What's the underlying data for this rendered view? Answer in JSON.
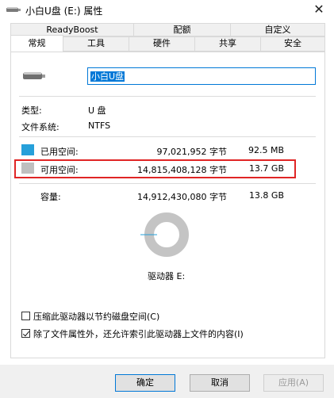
{
  "window": {
    "title": "小白U盘 (E:) 属性",
    "close_symbol": "✕"
  },
  "tabs_row1": [
    "ReadyBoost",
    "配额",
    "自定义"
  ],
  "tabs_row2": [
    "常规",
    "工具",
    "硬件",
    "共享",
    "安全"
  ],
  "active_tab": "常规",
  "drive": {
    "name": "小白U盘"
  },
  "info": {
    "type_label": "类型:",
    "type_value": "U 盘",
    "fs_label": "文件系统:",
    "fs_value": "NTFS"
  },
  "space": {
    "used_label": "已用空间:",
    "used_bytes": "97,021,952 字节",
    "used_size": "92.5 MB",
    "used_color": "#26a0da",
    "free_label": "可用空间:",
    "free_bytes": "14,815,408,128 字节",
    "free_size": "13.7 GB",
    "free_color": "#bfbfbf",
    "cap_label": "容量:",
    "cap_bytes": "14,912,430,080 字节",
    "cap_size": "13.8 GB",
    "drive_label": "驱动器 E:"
  },
  "options": {
    "compress_label": "压缩此驱动器以节约磁盘空间(C)",
    "compress_checked": false,
    "index_label": "除了文件属性外，还允许索引此驱动器上文件的内容(I)",
    "index_checked": true
  },
  "buttons": {
    "ok": "确定",
    "cancel": "取消",
    "apply": "应用(A)"
  }
}
